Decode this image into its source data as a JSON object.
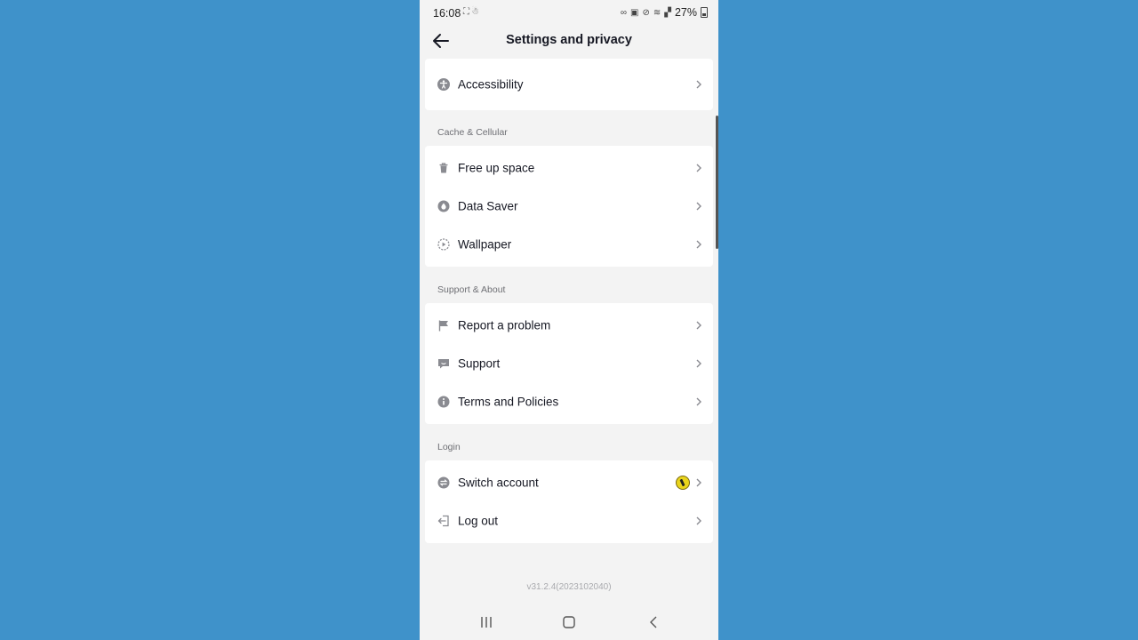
{
  "status_bar": {
    "time": "16:08",
    "left_icons": [
      "screenshot-icon",
      "snapchat-icon"
    ],
    "right_icons": [
      "link-icon",
      "nfc-icon",
      "mute-icon",
      "wifi-icon",
      "signal-icon"
    ],
    "battery": "27%"
  },
  "header": {
    "title": "Settings and privacy"
  },
  "sections": {
    "top": {
      "items": [
        {
          "label": "Accessibility",
          "icon": "accessibility-icon"
        }
      ]
    },
    "cache": {
      "title": "Cache & Cellular",
      "items": [
        {
          "label": "Free up space",
          "icon": "trash-icon"
        },
        {
          "label": "Data Saver",
          "icon": "data-saver-icon"
        },
        {
          "label": "Wallpaper",
          "icon": "wallpaper-icon"
        }
      ]
    },
    "support": {
      "title": "Support & About",
      "items": [
        {
          "label": "Report a problem",
          "icon": "flag-icon"
        },
        {
          "label": "Support",
          "icon": "chat-icon"
        },
        {
          "label": "Terms and Policies",
          "icon": "info-icon"
        }
      ]
    },
    "login": {
      "title": "Login",
      "items": [
        {
          "label": "Switch account",
          "icon": "switch-icon"
        },
        {
          "label": "Log out",
          "icon": "logout-icon"
        }
      ]
    }
  },
  "footer": {
    "version": "v31.2.4(2023102040)"
  },
  "colors": {
    "page_background": "#3f92ca",
    "screen_background": "#f3f3f3",
    "card_background": "#ffffff",
    "text_primary": "#161823",
    "text_secondary": "#6e6f74",
    "icon_gray": "#8a8b91"
  }
}
